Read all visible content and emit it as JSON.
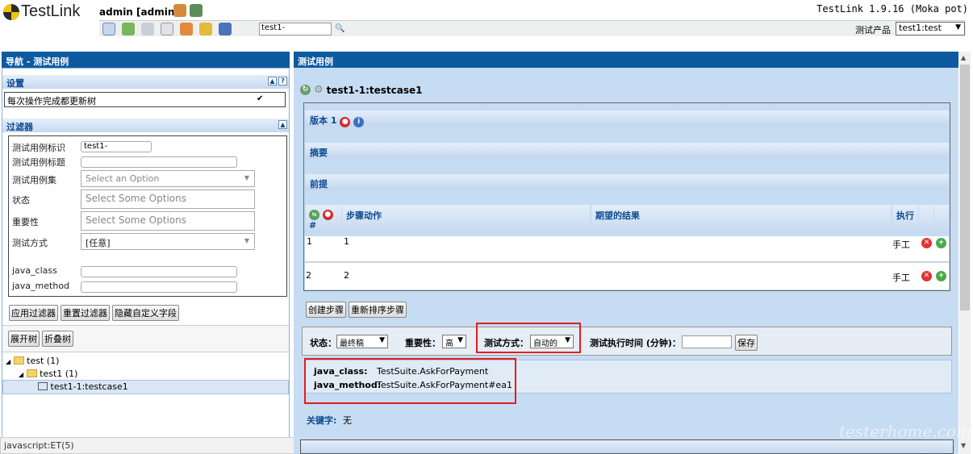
{
  "header": {
    "app_name": "TestLink",
    "user": "admin [admin]",
    "search_value": "test1-",
    "version": "TestLink 1.9.16 (Moka pot)",
    "product_label": "测试产品",
    "product_value": "test1:test"
  },
  "left": {
    "title": "导航 - 测试用例",
    "settings_label": "设置",
    "settings_option": "每次操作完成都更新树",
    "filter_label": "过滤器",
    "filters": {
      "tc_id_label": "测试用例标识",
      "tc_id_value": "test1-",
      "tc_title_label": "测试用例标题",
      "suite_label": "测试用例集",
      "suite_placeholder": "Select an Option",
      "status_label": "状态",
      "status_placeholder": "Select Some Options",
      "importance_label": "重要性",
      "importance_placeholder": "Select Some Options",
      "exec_label": "测试方式",
      "exec_value": "[任意]",
      "java_class_label": "java_class",
      "java_method_label": "java_method"
    },
    "buttons": {
      "apply": "应用过滤器",
      "reset": "重置过滤器",
      "hide": "隐藏自定义字段",
      "expand": "展开树",
      "collapse": "折叠树"
    },
    "tree": {
      "root": "test (1)",
      "child": "test1 (1)",
      "leaf": "test1-1:testcase1"
    },
    "statusbar": "javascript:ET(5)"
  },
  "right": {
    "title": "测试用例",
    "testcase": "test1-1:testcase1",
    "version": "版本 1",
    "summary": "摘要",
    "preconditions": "前提",
    "col_num": "#",
    "col_steps": "步骤动作",
    "col_expected": "期望的结果",
    "col_exec": "执行",
    "steps": [
      {
        "num": "1",
        "action": "1",
        "mode": "手工"
      },
      {
        "num": "2",
        "action": "2",
        "mode": "手工"
      }
    ],
    "create_step": "创建步骤",
    "reorder": "重新排序步骤",
    "status_label": "状态：",
    "status_value": "最终稿",
    "importance_label": "重要性：",
    "importance_value": "高",
    "exec_type_label": "测试方式：",
    "exec_type_value": "自动的",
    "duration_label": "测试执行时间 (分钟)：",
    "save": "保存",
    "cf": [
      {
        "name": "java_class:",
        "value": "TestSuite.AskForPayment"
      },
      {
        "name": "java_method:",
        "value": "TestSuite.AskForPayment#ea1"
      }
    ],
    "keywords_label": "关键字:",
    "keywords_value": "无",
    "watermark": "testerhome.com"
  },
  "colors": {
    "accent": "#0d5aa0",
    "highlight": "#e21d1d"
  }
}
